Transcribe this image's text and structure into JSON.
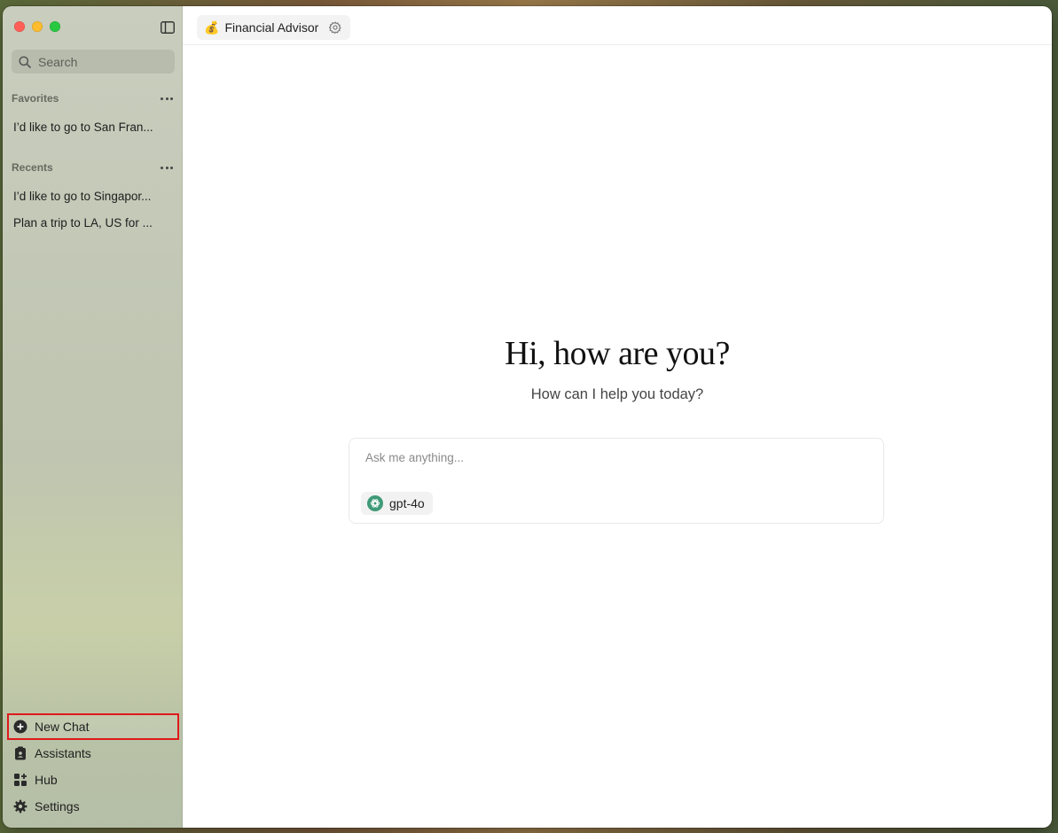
{
  "header": {
    "assistant_emoji": "💰",
    "assistant_name": "Financial Advisor"
  },
  "sidebar": {
    "search_placeholder": "Search",
    "favorites": {
      "title": "Favorites",
      "items": [
        "I’d like to go to San Fran..."
      ]
    },
    "recents": {
      "title": "Recents",
      "items": [
        "I’d like to go to Singapor...",
        "Plan a trip to LA, US for ..."
      ]
    },
    "bottom": {
      "new_chat": "New Chat",
      "assistants": "Assistants",
      "hub": "Hub",
      "settings": "Settings"
    }
  },
  "main": {
    "greeting": "Hi, how are you?",
    "subgreeting": "How can I help you today?",
    "composer_placeholder": "Ask me anything...",
    "model_name": "gpt-4o"
  },
  "colors": {
    "highlight_outline": "#e0181b",
    "model_logo": "#3f9a78"
  }
}
